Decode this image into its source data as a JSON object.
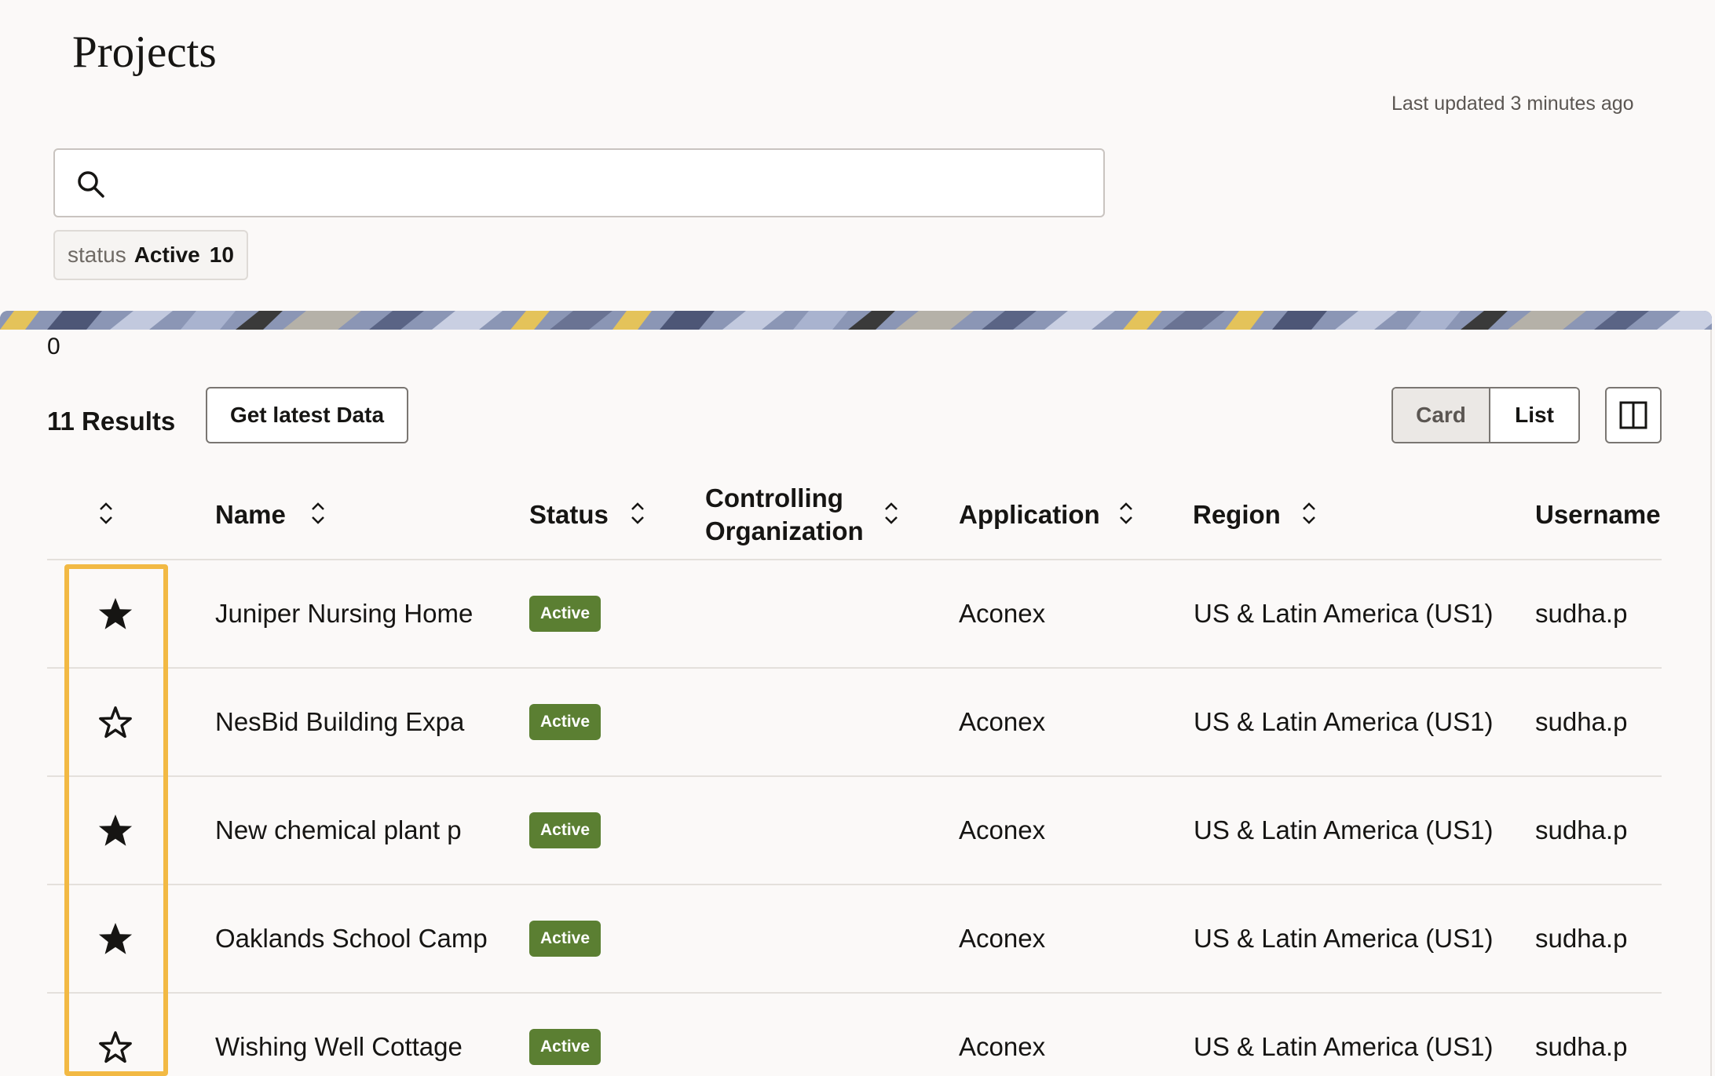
{
  "header": {
    "title": "Projects",
    "last_updated": "Last updated 3 minutes ago"
  },
  "search": {
    "value": "",
    "icon": "search-icon"
  },
  "filter_chip": {
    "key": "status",
    "value": "Active",
    "count": "10"
  },
  "toolbar": {
    "counter": "0",
    "results_label": "11 Results",
    "get_latest_label": "Get latest Data",
    "view_card_label": "Card",
    "view_list_label": "List",
    "selected_view": "Card"
  },
  "table": {
    "columns": [
      "Name",
      "Status",
      "Controlling Organization",
      "Application",
      "Region",
      "Username"
    ],
    "rows": [
      {
        "favorite": true,
        "name": "Juniper Nursing Home",
        "status": "Active",
        "org": "",
        "application": "Aconex",
        "region": "US & Latin America (US1)",
        "username": "sudha.p"
      },
      {
        "favorite": false,
        "name": "NesBid Building Expa",
        "status": "Active",
        "org": "",
        "application": "Aconex",
        "region": "US & Latin America (US1)",
        "username": "sudha.p"
      },
      {
        "favorite": true,
        "name": "New chemical plant p",
        "status": "Active",
        "org": "",
        "application": "Aconex",
        "region": "US & Latin America (US1)",
        "username": "sudha.p"
      },
      {
        "favorite": true,
        "name": "Oaklands School Camp",
        "status": "Active",
        "org": "",
        "application": "Aconex",
        "region": "US & Latin America (US1)",
        "username": "sudha.p"
      },
      {
        "favorite": false,
        "name": "Wishing Well Cottage",
        "status": "Active",
        "org": "",
        "application": "Aconex",
        "region": "US & Latin America (US1)",
        "username": "sudha.p"
      }
    ]
  },
  "colors": {
    "status_active": "#5b7f32",
    "highlight": "#f2b944",
    "background": "#fbf9f8"
  }
}
